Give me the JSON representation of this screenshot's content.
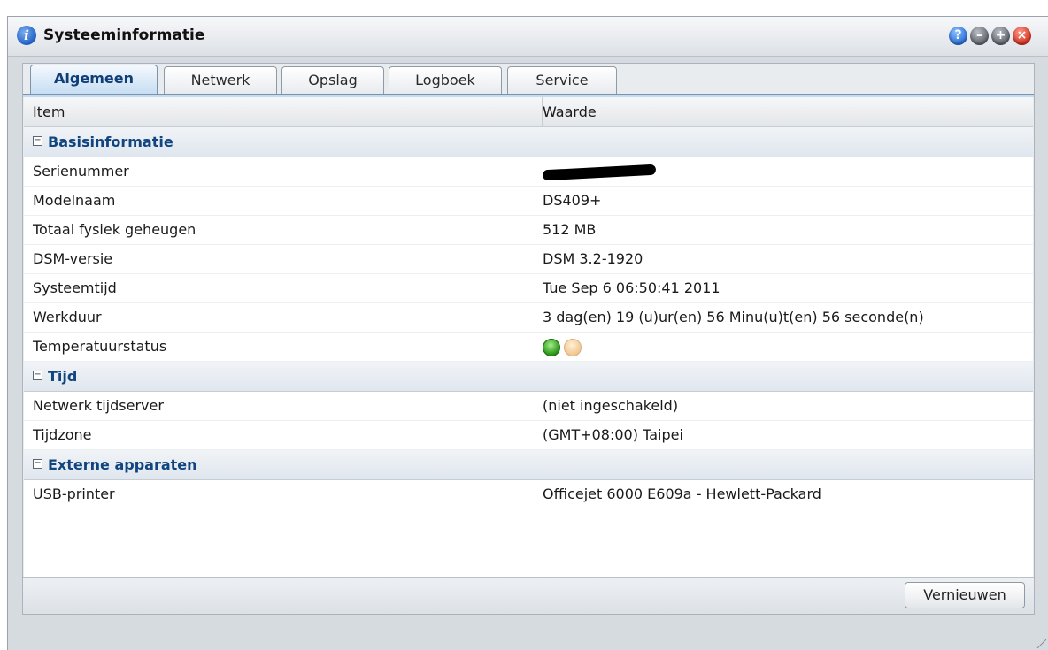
{
  "window": {
    "title": "Systeeminformatie",
    "controls": {
      "help": "?",
      "min": "–",
      "max": "+",
      "close": "×"
    }
  },
  "tabs": [
    "Algemeen",
    "Netwerk",
    "Opslag",
    "Logboek",
    "Service"
  ],
  "active_tab": "Algemeen",
  "grid": {
    "headers": {
      "item": "Item",
      "value": "Waarde"
    },
    "groups": {
      "basis": {
        "label": "Basisinformatie",
        "rows": [
          {
            "item": "Serienummer",
            "value": ""
          },
          {
            "item": "Modelnaam",
            "value": "DS409+"
          },
          {
            "item": "Totaal fysiek geheugen",
            "value": "512 MB"
          },
          {
            "item": "DSM-versie",
            "value": "DSM 3.2-1920"
          },
          {
            "item": "Systeemtijd",
            "value": "Tue Sep 6 06:50:41 2011"
          },
          {
            "item": "Werkduur",
            "value": "3 dag(en) 19 (u)ur(en) 56 Minu(u)t(en) 56 seconde(n)"
          },
          {
            "item": "Temperatuurstatus",
            "value": ""
          }
        ]
      },
      "tijd": {
        "label": "Tijd",
        "rows": [
          {
            "item": "Netwerk tijdserver",
            "value": "(niet ingeschakeld)"
          },
          {
            "item": "Tijdzone",
            "value": "(GMT+08:00) Taipei"
          }
        ]
      },
      "extern": {
        "label": "Externe apparaten",
        "rows": [
          {
            "item": "USB-printer",
            "value": "Officejet 6000 E609a - Hewlett-Packard"
          }
        ]
      }
    }
  },
  "status_colors": {
    "ok": "#2e9a1c",
    "warn": "#f2c690"
  },
  "footer": {
    "refresh_label": "Vernieuwen"
  }
}
